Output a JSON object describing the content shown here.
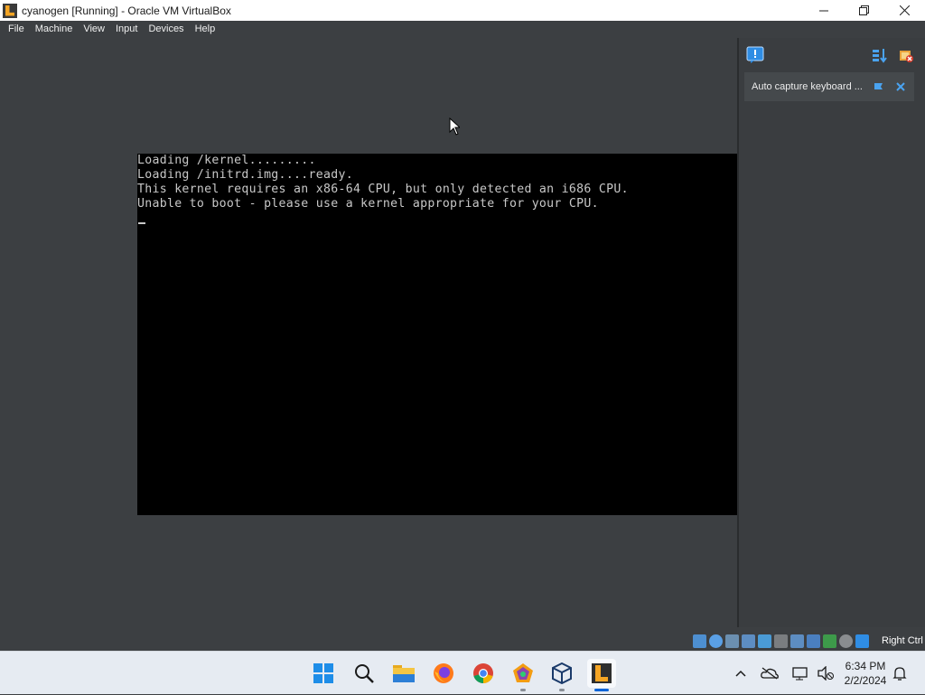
{
  "window": {
    "title": "cyanogen [Running] - Oracle VM VirtualBox"
  },
  "menu": {
    "items": [
      "File",
      "Machine",
      "View",
      "Input",
      "Devices",
      "Help"
    ]
  },
  "console": {
    "lines": [
      "Loading /kernel.........",
      "Loading /initrd.img....ready.",
      "This kernel requires an x86-64 CPU, but only detected an i686 CPU.",
      "Unable to boot - please use a kernel appropriate for your CPU."
    ]
  },
  "notification": {
    "text": "Auto capture keyboard ..."
  },
  "statusbar": {
    "host_key": "Right Ctrl"
  },
  "clock": {
    "time": "6:34 PM",
    "date": "2/2/2024"
  },
  "colors": {
    "vm_background": "#3c3f42",
    "console_bg": "#000000",
    "console_text": "#c8c8c8",
    "taskbar": "#e6ebf2",
    "accent": "#0a64d8"
  },
  "icons": {
    "taskbar": [
      "windows-start-icon",
      "search-icon",
      "file-explorer-icon",
      "firefox-icon",
      "chrome-icon",
      "pentagon-app-icon",
      "virtualbox-icon",
      "virtualbox-vm-icon"
    ],
    "tray": [
      "chevron-up-icon",
      "onedrive-icon",
      "network-icon",
      "volume-muted-icon",
      "notification-bell-icon"
    ]
  }
}
